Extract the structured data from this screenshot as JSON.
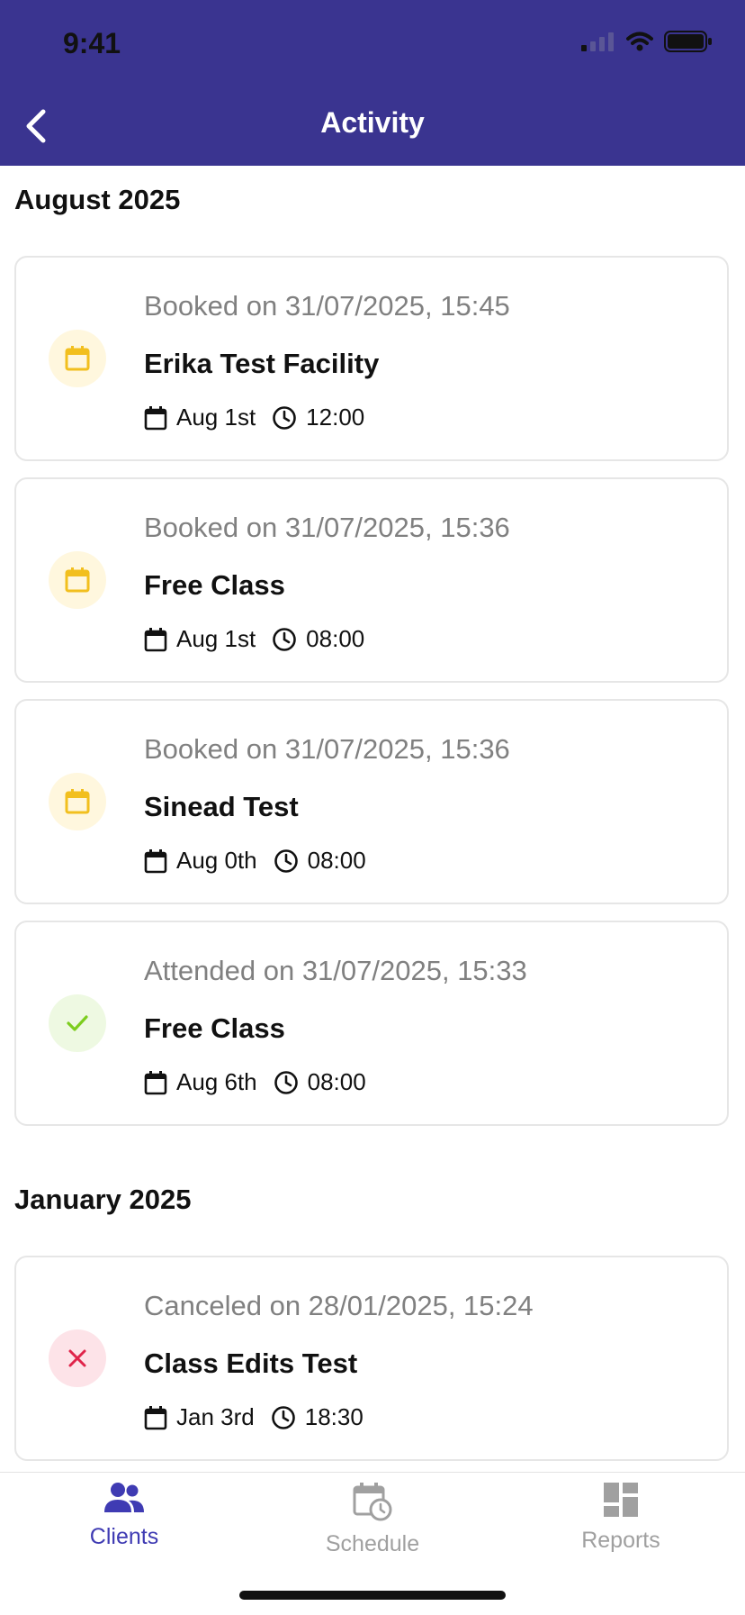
{
  "status_bar": {
    "time": "9:41"
  },
  "header": {
    "title": "Activity"
  },
  "sections": [
    {
      "title": "August 2025",
      "items": [
        {
          "status": "Booked on 31/07/2025, 15:45",
          "name": "Erika Test Facility",
          "date": "Aug 1st",
          "time": "12:00",
          "type": "booked"
        },
        {
          "status": "Booked on 31/07/2025, 15:36",
          "name": "Free Class",
          "date": "Aug 1st",
          "time": "08:00",
          "type": "booked"
        },
        {
          "status": "Booked on 31/07/2025, 15:36",
          "name": "Sinead Test",
          "date": "Aug 0th",
          "time": "08:00",
          "type": "booked"
        },
        {
          "status": "Attended on 31/07/2025, 15:33",
          "name": "Free Class",
          "date": "Aug 6th",
          "time": "08:00",
          "type": "attended"
        }
      ]
    },
    {
      "title": "January 2025",
      "items": [
        {
          "status": "Canceled on 28/01/2025, 15:24",
          "name": "Class Edits Test",
          "date": "Jan 3rd",
          "time": "18:30",
          "type": "canceled"
        }
      ]
    }
  ],
  "tabs": [
    {
      "label": "Clients",
      "icon": "users-icon",
      "active": true
    },
    {
      "label": "Schedule",
      "icon": "calendar-clock-icon",
      "active": false
    },
    {
      "label": "Reports",
      "icon": "dashboard-icon",
      "active": false
    }
  ],
  "colors": {
    "header": "#3a3490",
    "accent": "#3f3bb3",
    "booked_icon": "#f2bf1e",
    "booked_bg": "#fff7de",
    "attended_icon": "#7ccd1e",
    "attended_bg": "#eef9e2",
    "canceled_icon": "#e0244a",
    "canceled_bg": "#fde3e8",
    "inactive_tab": "#a0a0a0"
  }
}
